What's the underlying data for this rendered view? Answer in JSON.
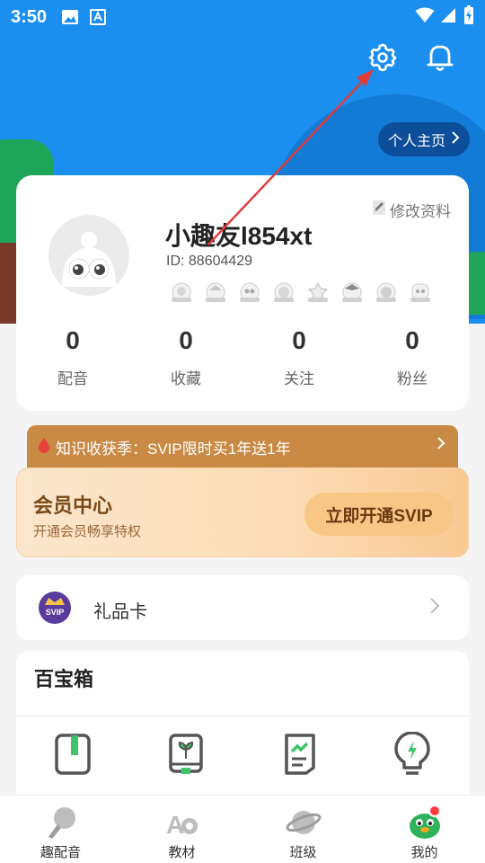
{
  "status_bar": {
    "time": "3:50"
  },
  "header": {
    "homepage_label": "个人主页"
  },
  "profile": {
    "edit_label": "修改资料",
    "username": "小趣友l854xt",
    "user_id": "ID: 88604429",
    "stats": [
      {
        "value": "0",
        "label": "配音"
      },
      {
        "value": "0",
        "label": "收藏"
      },
      {
        "value": "0",
        "label": "关注"
      },
      {
        "value": "0",
        "label": "粉丝"
      }
    ]
  },
  "promo": {
    "text": "知识收获季：SVIP限时买1年送1年"
  },
  "vip": {
    "title": "会员中心",
    "subtitle": "开通会员畅享特权",
    "button": "立即开通SVIP",
    "badge_text": "SVIP"
  },
  "gift_card": {
    "label": "礼品卡"
  },
  "toolbox": {
    "title": "百宝箱"
  },
  "bottom_nav": [
    {
      "label": "趣配音"
    },
    {
      "label": "教材"
    },
    {
      "label": "班级"
    },
    {
      "label": "我的"
    }
  ],
  "colors": {
    "hero_blue": "#1b8ff0",
    "vip_gold": "#f8c685",
    "promo_brown": "#c98a45",
    "annotation_red": "#e53935"
  }
}
